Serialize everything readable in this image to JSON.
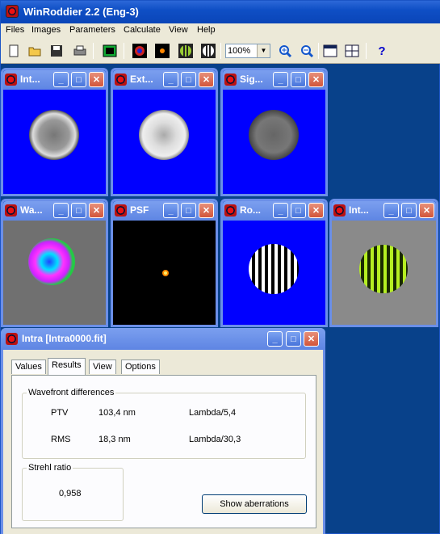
{
  "app": {
    "title": "WinRoddier 2.2 (Eng-3)"
  },
  "menu": [
    "Files",
    "Images",
    "Parameters",
    "Calculate",
    "View",
    "Help"
  ],
  "toolbar": {
    "zoom": "100%"
  },
  "windows": [
    {
      "title": "Int..."
    },
    {
      "title": "Ext..."
    },
    {
      "title": "Sig..."
    },
    {
      "title": "Wa..."
    },
    {
      "title": "PSF"
    },
    {
      "title": "Ro..."
    },
    {
      "title": "Int..."
    }
  ],
  "dialog": {
    "title": "Intra [Intra0000.fit]",
    "tabs": [
      "Values",
      "Results",
      "View",
      "Options"
    ],
    "wavefront": {
      "title": "Wavefront differences",
      "ptv_label": "PTV",
      "ptv_value": "103,4 nm",
      "ptv_lambda": "Lambda/5,4",
      "rms_label": "RMS",
      "rms_value": "18,3 nm",
      "rms_lambda": "Lambda/30,3"
    },
    "strehl": {
      "title": "Strehl ratio",
      "value": "0,958"
    },
    "show_aberrations": "Show aberrations"
  },
  "colors": {
    "image_bg": "#0000ff",
    "title_blue": "#0a45b8",
    "dialog_bg": "#ece9d8"
  }
}
